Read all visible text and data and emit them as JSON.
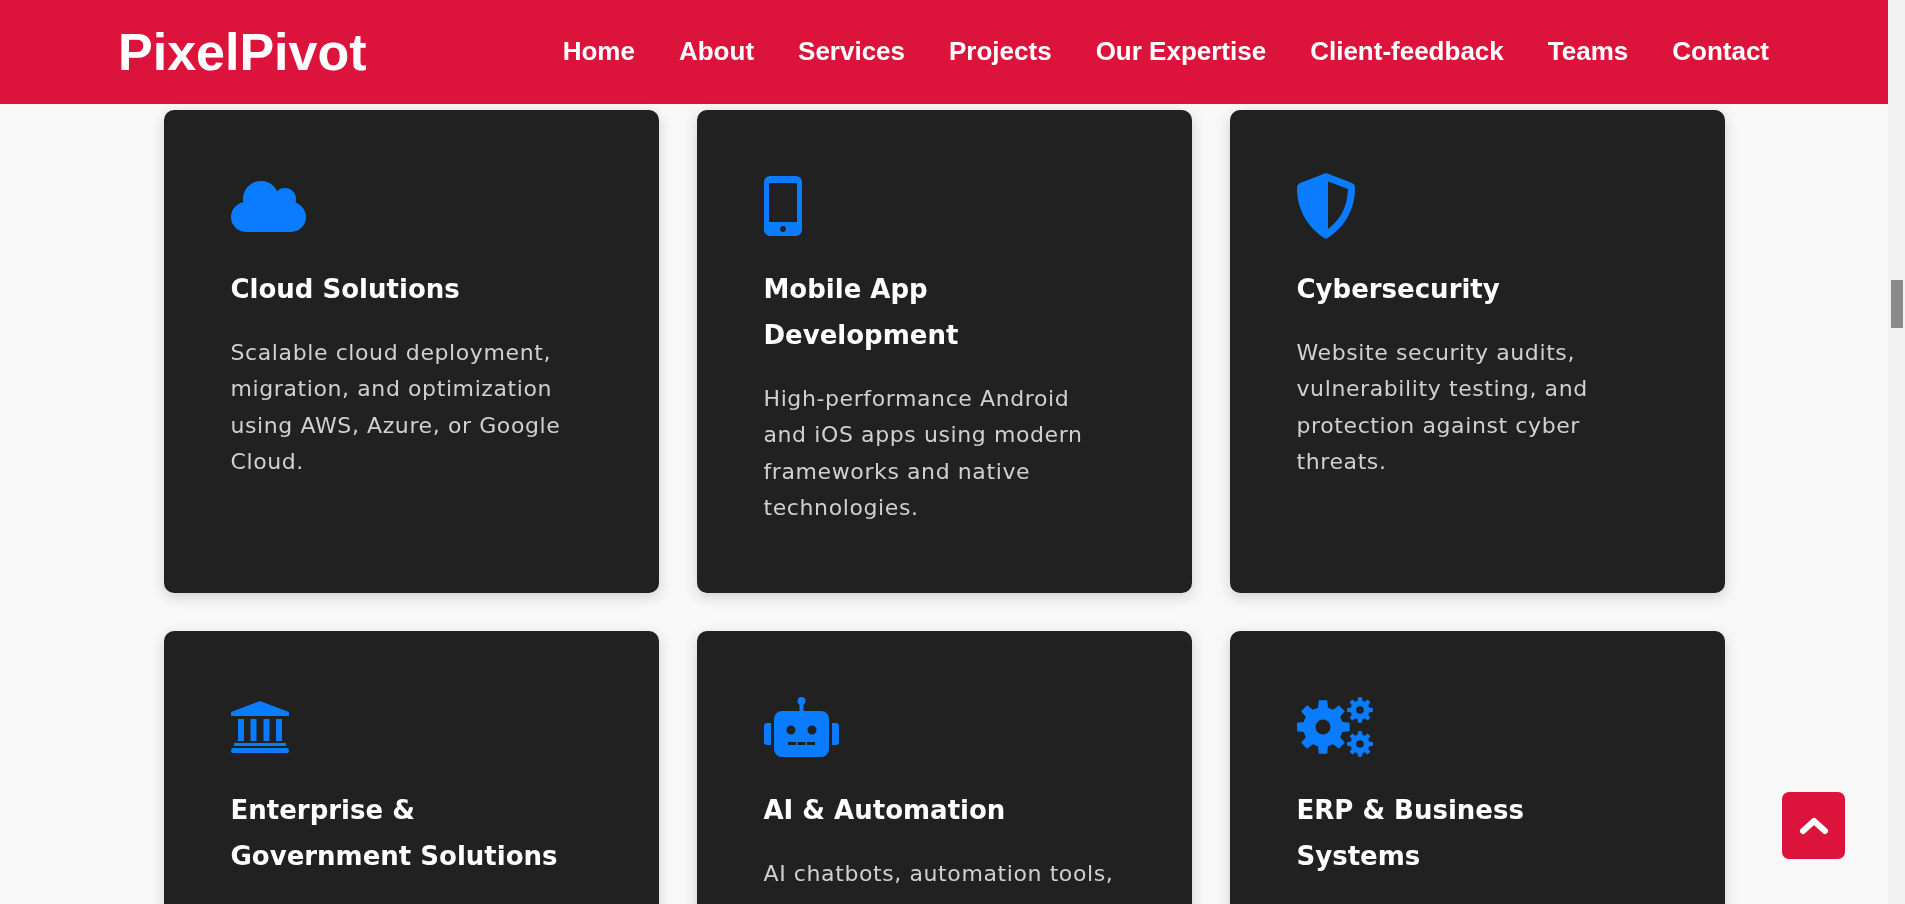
{
  "header": {
    "logo": "PixelPivot",
    "nav": [
      "Home",
      "About",
      "Services",
      "Projects",
      "Our Expertise",
      "Client-feedback",
      "Teams",
      "Contact"
    ]
  },
  "services": [
    {
      "kind": "cloud",
      "title": "Cloud Solutions",
      "description": "Scalable cloud deployment, migration, and optimization using AWS, Azure, or Google Cloud."
    },
    {
      "kind": "mobile",
      "title": "Mobile App Development",
      "description": "High-performance Android and iOS apps using modern frameworks and native technologies."
    },
    {
      "kind": "shield",
      "title": "Cybersecurity",
      "description": "Website security audits, vulnerability testing, and protection against cyber threats."
    },
    {
      "kind": "bank",
      "title": "Enterprise & Government Solutions"
    },
    {
      "kind": "robot",
      "title": "AI & Automation",
      "description": "AI chatbots, automation tools,"
    },
    {
      "kind": "gears",
      "title": "ERP & Business Systems"
    }
  ]
}
